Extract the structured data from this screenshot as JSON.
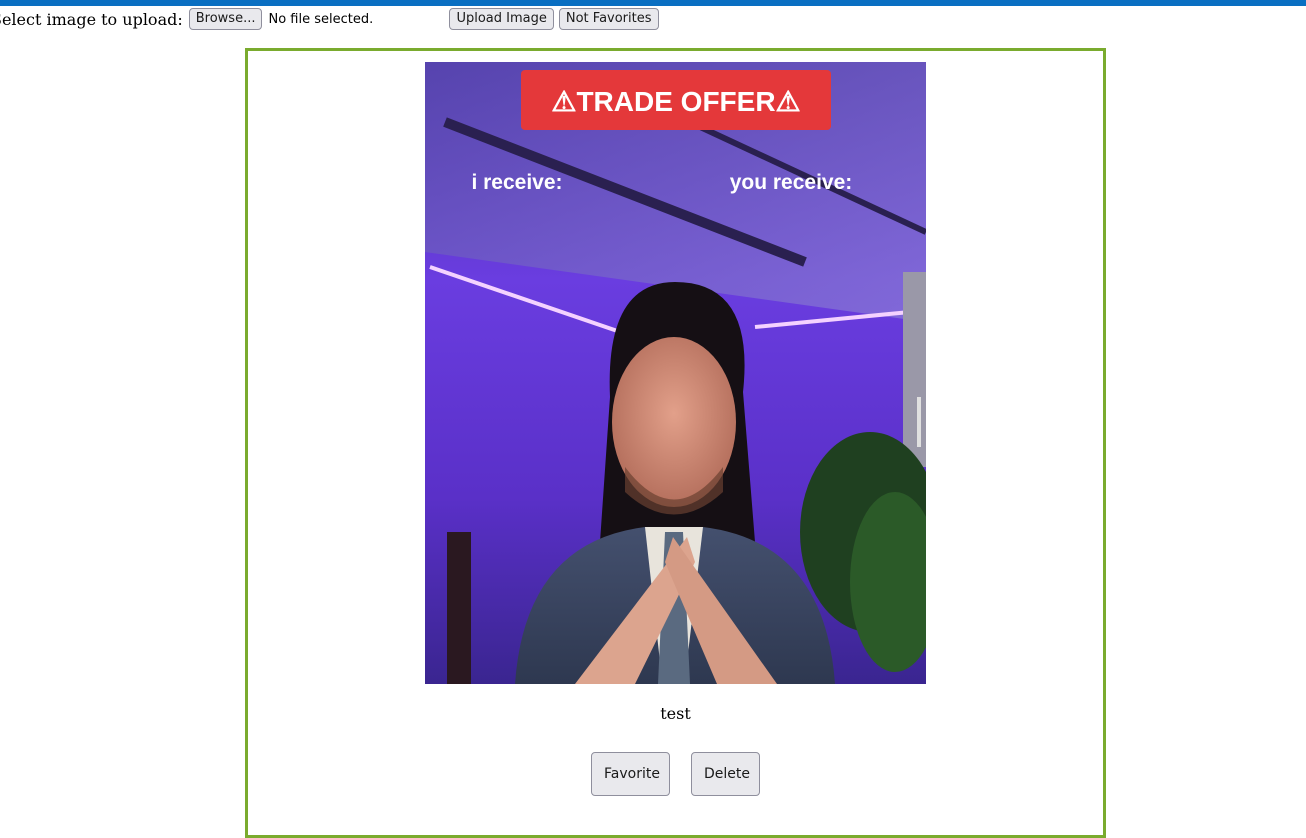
{
  "upload": {
    "label": "Select image to upload:",
    "browse_label": "Browse...",
    "file_status": "No file selected.",
    "upload_label": "Upload Image",
    "not_favorites_label": "Not Favorites"
  },
  "colors": {
    "top_bar": "#0a6fc2",
    "card_border": "#7aab2e"
  },
  "image_card": {
    "meme": {
      "banner_text": "⚠TRADE OFFER⚠",
      "left_text": "i receive:",
      "right_text": "you receive:"
    },
    "caption": "test",
    "favorite_label": "Favorite",
    "delete_label": "Delete"
  }
}
